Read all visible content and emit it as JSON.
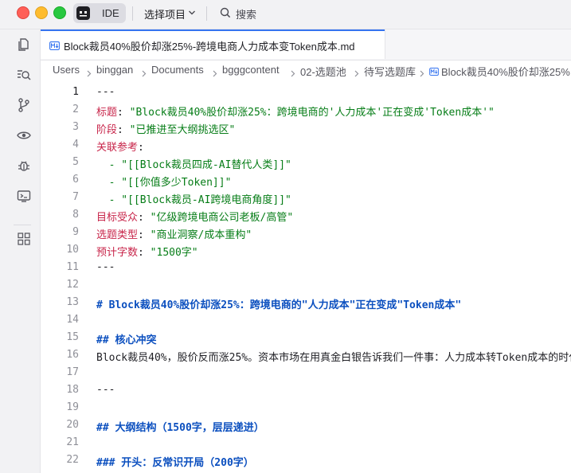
{
  "titlebar": {
    "ide_label": "IDE",
    "project_label": "选择项目",
    "search_label": "搜索"
  },
  "tab": {
    "label": "Block裁员40%股价却涨25%-跨境电商人力成本变Token成本.md"
  },
  "breadcrumb": [
    "Users",
    "binggan",
    "Documents",
    "bgggcontent",
    "02-选题池",
    "待写选题库",
    "Block裁员40%股价却涨25%"
  ],
  "editor": {
    "current_line": "1",
    "lines": [
      {
        "n": "1",
        "parts": [
          {
            "c": "p",
            "t": "---"
          }
        ]
      },
      {
        "n": "2",
        "parts": [
          {
            "c": "k",
            "t": "标题"
          },
          {
            "c": "p",
            "t": ": "
          },
          {
            "c": "s",
            "t": "\"Block裁员40%股价却涨25%：跨境电商的'人力成本'正在变成'Token成本'\""
          }
        ]
      },
      {
        "n": "3",
        "parts": [
          {
            "c": "k",
            "t": "阶段"
          },
          {
            "c": "p",
            "t": ": "
          },
          {
            "c": "s",
            "t": "\"已推进至大纲挑选区\""
          }
        ]
      },
      {
        "n": "4",
        "parts": [
          {
            "c": "k",
            "t": "关联参考"
          },
          {
            "c": "p",
            "t": ":"
          }
        ]
      },
      {
        "n": "5",
        "parts": [
          {
            "c": "p",
            "t": "  "
          },
          {
            "c": "s",
            "t": "- \"[[Block裁员四成-AI替代人类]]\""
          }
        ]
      },
      {
        "n": "6",
        "parts": [
          {
            "c": "p",
            "t": "  "
          },
          {
            "c": "s",
            "t": "- \"[[你值多少Token]]\""
          }
        ]
      },
      {
        "n": "7",
        "parts": [
          {
            "c": "p",
            "t": "  "
          },
          {
            "c": "s",
            "t": "- \"[[Block裁员-AI跨境电商角度]]\""
          }
        ]
      },
      {
        "n": "8",
        "parts": [
          {
            "c": "k",
            "t": "目标受众"
          },
          {
            "c": "p",
            "t": ": "
          },
          {
            "c": "s",
            "t": "\"亿级跨境电商公司老板/高管\""
          }
        ]
      },
      {
        "n": "9",
        "parts": [
          {
            "c": "k",
            "t": "选题类型"
          },
          {
            "c": "p",
            "t": ": "
          },
          {
            "c": "s",
            "t": "\"商业洞察/成本重构\""
          }
        ]
      },
      {
        "n": "10",
        "parts": [
          {
            "c": "k",
            "t": "预计字数"
          },
          {
            "c": "p",
            "t": ": "
          },
          {
            "c": "s",
            "t": "\"1500字\""
          }
        ]
      },
      {
        "n": "11",
        "parts": [
          {
            "c": "p",
            "t": "---"
          }
        ]
      },
      {
        "n": "12",
        "parts": []
      },
      {
        "n": "13",
        "parts": [
          {
            "c": "h",
            "t": "# Block裁员40%股价却涨25%：跨境电商的\"人力成本\"正在变成\"Token成本\""
          }
        ]
      },
      {
        "n": "14",
        "parts": []
      },
      {
        "n": "15",
        "parts": [
          {
            "c": "h",
            "t": "## 核心冲突"
          }
        ]
      },
      {
        "n": "16",
        "parts": [
          {
            "c": "p",
            "t": "Block裁员40%，股价反而涨25%。资本市场在用真金白银告诉我们一件事：人力成本转Token成本的时代"
          }
        ]
      },
      {
        "n": "17",
        "parts": []
      },
      {
        "n": "18",
        "parts": [
          {
            "c": "p",
            "t": "---"
          }
        ]
      },
      {
        "n": "19",
        "parts": []
      },
      {
        "n": "20",
        "parts": [
          {
            "c": "h",
            "t": "## 大纲结构（1500字，层层递进）"
          }
        ]
      },
      {
        "n": "21",
        "parts": []
      },
      {
        "n": "22",
        "parts": [
          {
            "c": "h",
            "t": "### 开头：反常识开局（200字）"
          }
        ]
      }
    ]
  },
  "colors": {
    "accent": "#3574f0",
    "yaml_key": "#c8254a",
    "string": "#067d17",
    "heading": "#0b4fbf"
  },
  "icons": {
    "sidebar": [
      "project-files-icon",
      "find-in-files-icon",
      "git-branch-icon",
      "preview-eye-icon",
      "debug-bug-icon",
      "terminal-icon",
      "plugins-grid-icon"
    ],
    "tab": "markdown-file-icon",
    "search": "search-icon"
  }
}
